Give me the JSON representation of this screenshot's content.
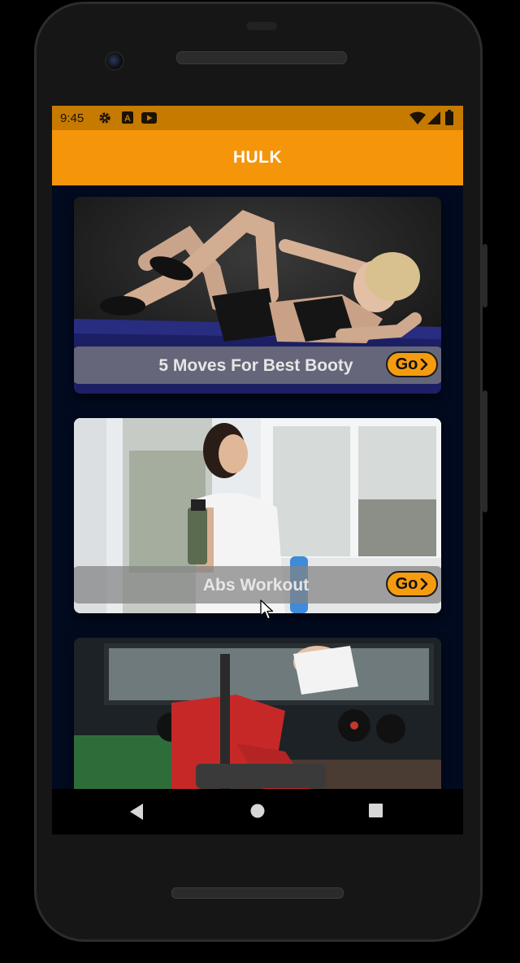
{
  "status_bar": {
    "time": "9:45",
    "icons": [
      "gear-icon",
      "a-box-icon",
      "play-icon",
      "wifi-icon",
      "signal-icon",
      "battery-icon"
    ]
  },
  "app_bar": {
    "title": "HULK",
    "color": "#f5950a"
  },
  "cards": [
    {
      "title": "5 Moves For Best Booty",
      "go_label": "Go",
      "image": "woman doing crunches on mat"
    },
    {
      "title": "Abs Workout",
      "go_label": "Go",
      "image": "woman holding shaker by window"
    },
    {
      "title": "",
      "go_label": "",
      "image": "woman lifting dumbbell in gym"
    }
  ],
  "nav_bar": {
    "buttons": [
      "back-icon",
      "home-icon",
      "recents-icon"
    ]
  },
  "colors": {
    "accent": "#f5950a",
    "background": "#020a1f",
    "overlay": "#828282"
  }
}
